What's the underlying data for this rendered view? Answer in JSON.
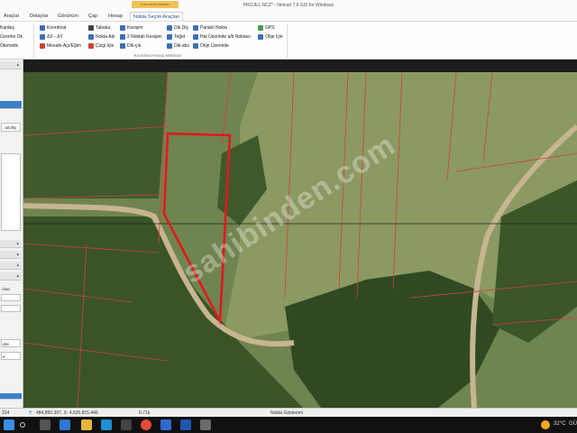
{
  "window": {
    "title": "PROJE1.NCZ* - Netcad 7.6 GIS for Windows",
    "contextual_tab_group": "Koordinat Araçları"
  },
  "menu": {
    "items": [
      "Araçlar",
      "Detaylar",
      "Görünüm",
      "Çap",
      "Hesap",
      "Nokta Seçim Araçları"
    ],
    "active_item": "Nokta Seçim Araçları"
  },
  "ribbon": {
    "left_cut": [
      "Kardeş",
      "Üzerine Ok",
      "Ötemetik"
    ],
    "col1": [
      "Koordinat",
      "ΔX - ΔY",
      "Mesafe-Açı/Eğim"
    ],
    "col2": [
      "Tabaka",
      "Nokta Adı",
      "Çizgi İçle"
    ],
    "col3": [
      "Kesişim",
      "2 Noktalı Kesişim",
      "Dik-çık"
    ],
    "col4": [
      "Dik Diş",
      "Teğet",
      "Dik-abs"
    ],
    "col5": [
      "Paralel Nokta",
      "Hat Üzerinde a/b Noktası",
      "Obje Üzerinde"
    ],
    "col6": [
      "GPS",
      "Obje İçle"
    ],
    "group_label": "Koordinat Hesap Makinası"
  },
  "left_panel": {
    "field_label": "Alan",
    "tail_labels": [
      "..tability",
      "dile",
      "e"
    ]
  },
  "map": {
    "watermark": "sahibinden.com"
  },
  "statusbar": {
    "coord_prefix": "Y:",
    "coordinates": "484,850.397, X: 4,526,815.446",
    "scale": "0.71k",
    "message": "Nokta Gösterimi",
    "left_code": "314"
  },
  "taskbar": {
    "weather": "32°C",
    "weather_suffix": "GÜ",
    "icons": [
      "windows-logo",
      "search",
      "task-view",
      "file-explorer",
      "edge",
      "store",
      "mail",
      "chrome",
      "photos",
      "word",
      "netcad"
    ]
  },
  "colors": {
    "parcel_highlight": "#e5161b",
    "parcel_lines": "#d04040",
    "ribbon_accent": "#3d6fb4"
  }
}
